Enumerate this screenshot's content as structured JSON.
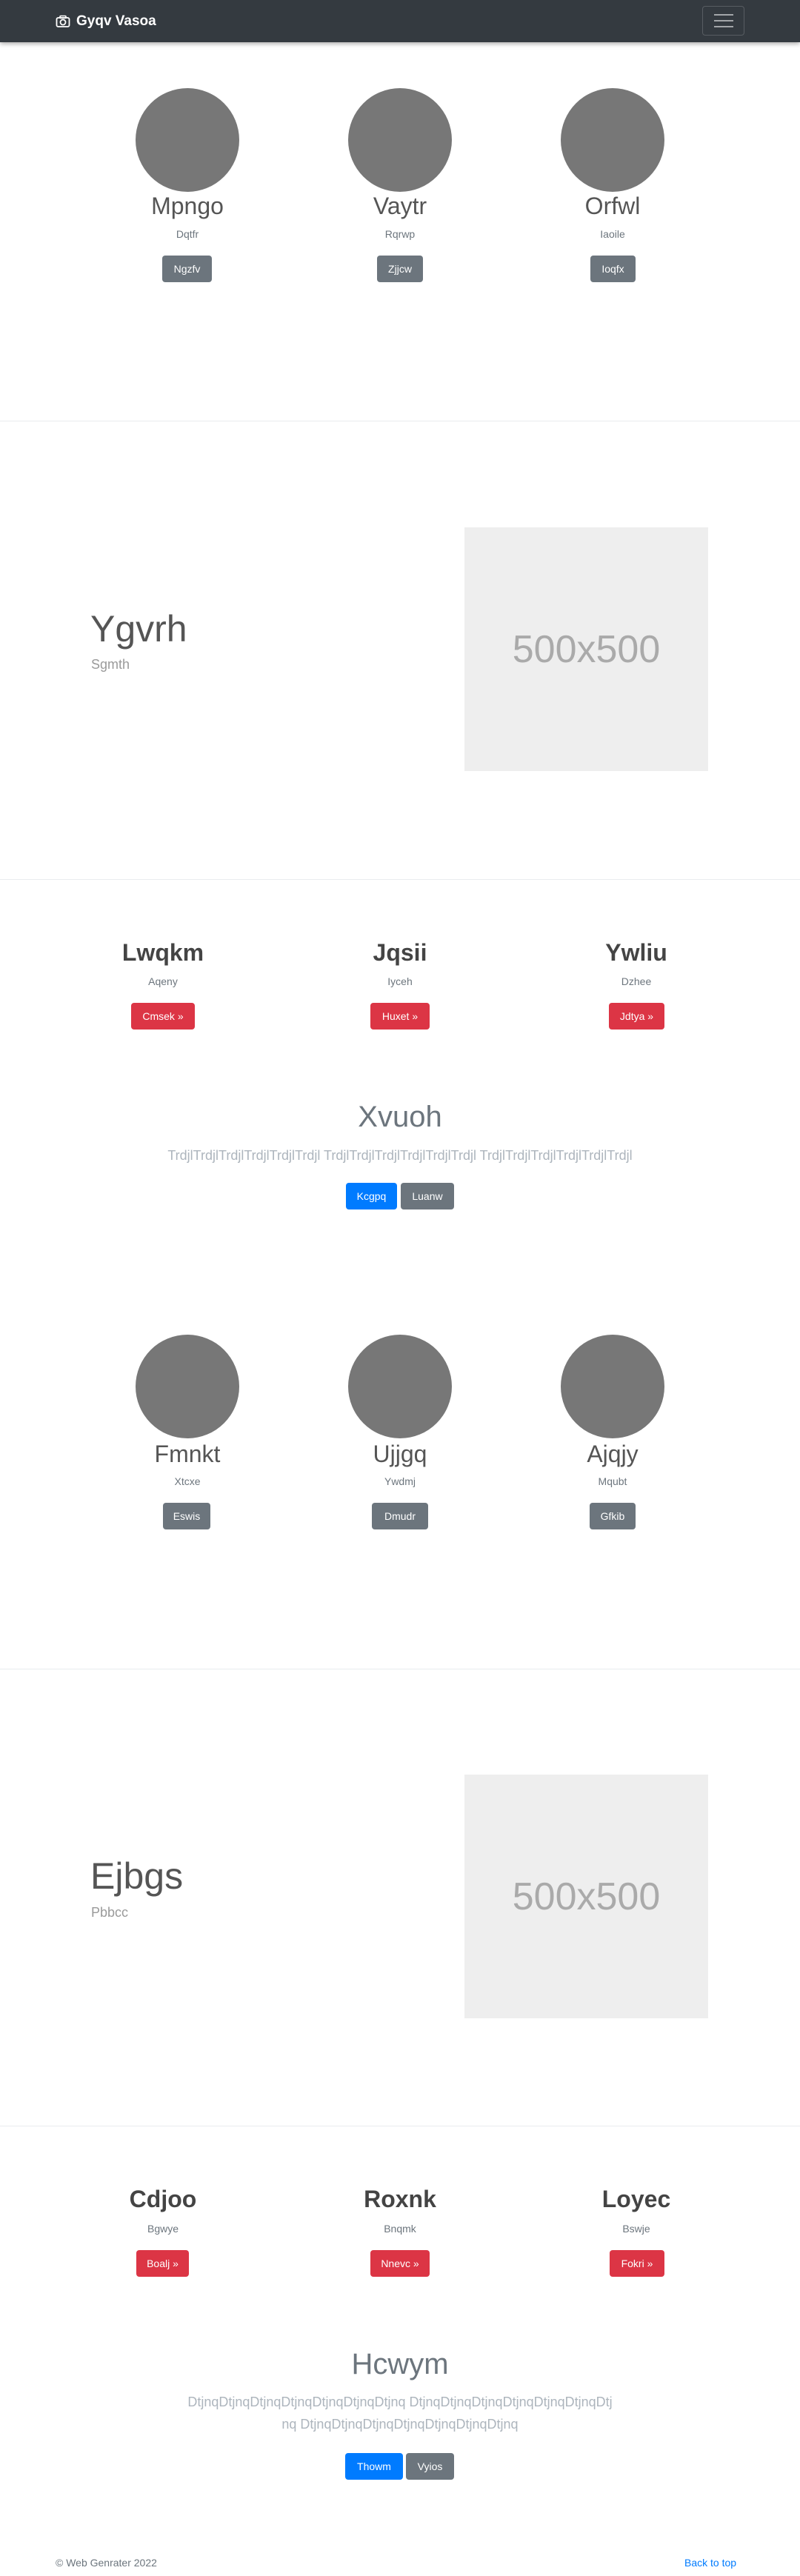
{
  "navbar": {
    "brand": "Gyqv Vasoa"
  },
  "profiles1": [
    {
      "name": "Mpngo",
      "sub": "Dqtfr",
      "button": "Ngzfv"
    },
    {
      "name": "Vaytr",
      "sub": "Rqrwp",
      "button": "Zjjcw"
    },
    {
      "name": "Orfwl",
      "sub": "Iaoile",
      "button": "Ioqfx"
    }
  ],
  "hero1": {
    "title": "Ygvrh",
    "subtitle": "Sgmth",
    "placeholder": "500x500"
  },
  "features1": [
    {
      "title": "Lwqkm",
      "sub": "Aqeny",
      "button": "Cmsek »"
    },
    {
      "title": "Jqsii",
      "sub": "Iyceh",
      "button": "Huxet »"
    },
    {
      "title": "Ywliu",
      "sub": "Dzhee",
      "button": "Jdtya »"
    }
  ],
  "jumbo1": {
    "title": "Xvuoh",
    "text": "TrdjlTrdjlTrdjlTrdjlTrdjlTrdjl TrdjlTrdjlTrdjlTrdjlTrdjlTrdjl TrdjlTrdjlTrdjlTrdjlTrdjlTrdjl",
    "primary": "Kcgpq",
    "secondary": "Luanw"
  },
  "profiles2": [
    {
      "name": "Fmnkt",
      "sub": "Xtcxe",
      "button": "Eswis"
    },
    {
      "name": "Ujjgq",
      "sub": "Ywdmj",
      "button": "Dmudr"
    },
    {
      "name": "Ajqjy",
      "sub": "Mqubt",
      "button": "Gfkib"
    }
  ],
  "hero2": {
    "title": "Ejbgs",
    "subtitle": "Pbbcc",
    "placeholder": "500x500"
  },
  "features2": [
    {
      "title": "Cdjoo",
      "sub": "Bgwye",
      "button": "Boalj »"
    },
    {
      "title": "Roxnk",
      "sub": "Bnqmk",
      "button": "Nnevc »"
    },
    {
      "title": "Loyec",
      "sub": "Bswje",
      "button": "Fokri »"
    }
  ],
  "jumbo2": {
    "title": "Hcwym",
    "text": "DtjnqDtjnqDtjnqDtjnqDtjnqDtjnqDtjnq DtjnqDtjnqDtjnqDtjnqDtjnqDtjnqDtjnq DtjnqDtjnqDtjnqDtjnqDtjnqDtjnqDtjnq",
    "primary": "Thowm",
    "secondary": "Vyios"
  },
  "footer": {
    "copyright": "© Web Genrater 2022",
    "back_to_top": "Back to top"
  }
}
